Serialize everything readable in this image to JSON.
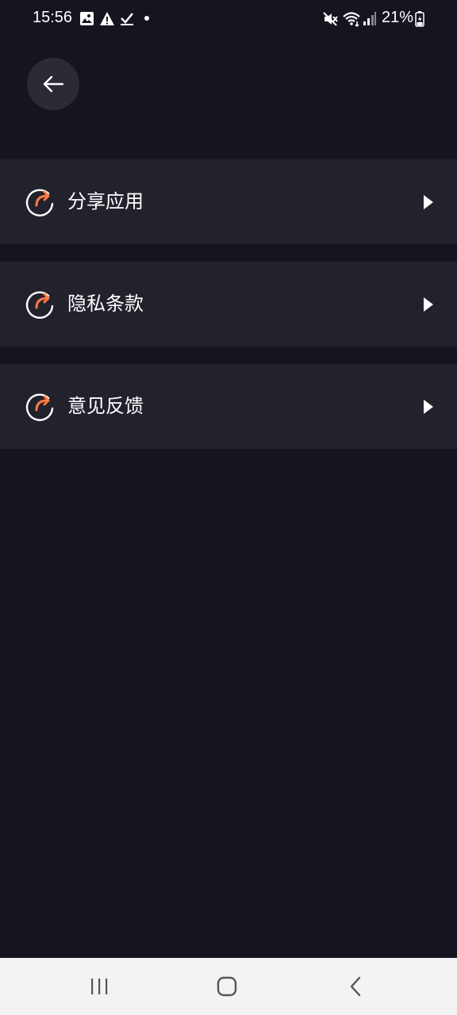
{
  "status_bar": {
    "time": "15:56",
    "battery": "21%",
    "left_icons": [
      "image-icon",
      "warning-icon",
      "check-icon",
      "dot-icon"
    ],
    "right_icons": [
      "mute-icon",
      "wifi-icon",
      "signal-icon",
      "battery-icon"
    ]
  },
  "header": {
    "back_icon": "arrow-left-icon"
  },
  "menu": {
    "items": [
      {
        "label": "分享应用",
        "icon": "share-arrow-icon"
      },
      {
        "label": "隐私条款",
        "icon": "share-arrow-icon"
      },
      {
        "label": "意见反馈",
        "icon": "share-arrow-icon"
      }
    ]
  },
  "nav_bar": {
    "buttons": [
      "recent-apps",
      "home",
      "back"
    ]
  },
  "colors": {
    "background": "#151520",
    "card": "#22222d",
    "accent": "#ff7a45",
    "back_circle": "#2b2b35"
  }
}
